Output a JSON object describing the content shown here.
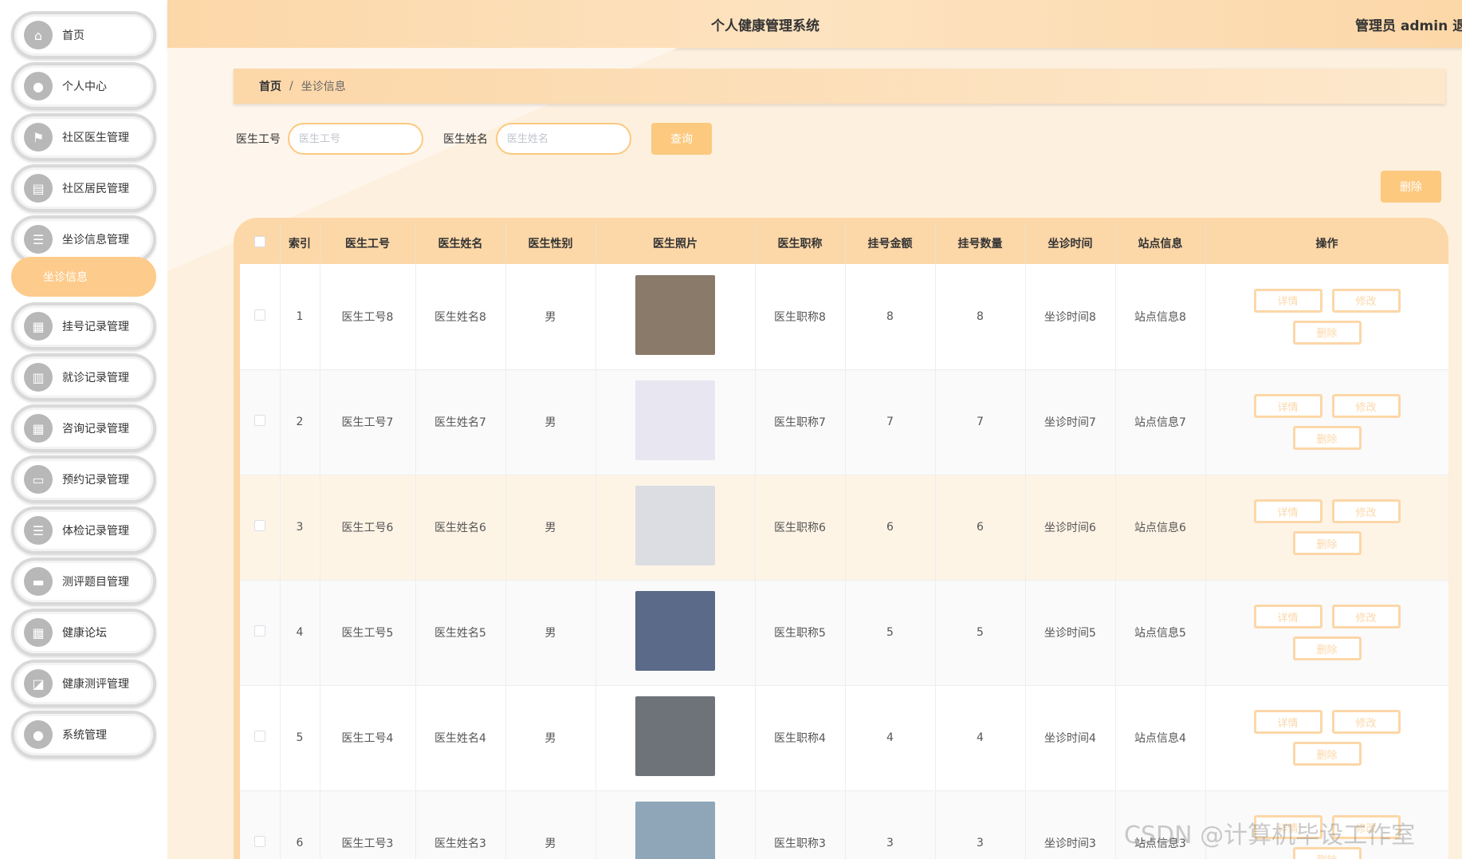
{
  "header": {
    "title": "个人健康管理系统",
    "user": "管理员 admin  退出"
  },
  "sidebar": {
    "items": [
      {
        "label": "首页",
        "icon": "home-icon",
        "glyph": "⌂"
      },
      {
        "label": "个人中心",
        "icon": "user-icon",
        "glyph": "●"
      },
      {
        "label": "社区医生管理",
        "icon": "flag-icon",
        "glyph": "⚑"
      },
      {
        "label": "社区居民管理",
        "icon": "clipboard-icon",
        "glyph": "▤"
      },
      {
        "label": "坐诊信息管理",
        "icon": "sliders-icon",
        "glyph": "☰"
      },
      {
        "label": "挂号记录管理",
        "icon": "grid-icon",
        "glyph": "▦"
      },
      {
        "label": "就诊记录管理",
        "icon": "chart-icon",
        "glyph": "▥"
      },
      {
        "label": "咨询记录管理",
        "icon": "grid-icon",
        "glyph": "▦"
      },
      {
        "label": "预约记录管理",
        "icon": "monitor-icon",
        "glyph": "▭"
      },
      {
        "label": "体检记录管理",
        "icon": "list-icon",
        "glyph": "☰"
      },
      {
        "label": "测评题目管理",
        "icon": "message-icon",
        "glyph": "▬"
      },
      {
        "label": "健康论坛",
        "icon": "grid-icon",
        "glyph": "▦"
      },
      {
        "label": "健康测评管理",
        "icon": "chart-line-icon",
        "glyph": "◪"
      },
      {
        "label": "系统管理",
        "icon": "user-icon",
        "glyph": "●"
      }
    ],
    "sub_item": "坐诊信息"
  },
  "breadcrumb": {
    "home": "首页",
    "separator": "/",
    "current": "坐诊信息"
  },
  "search": {
    "id_label": "医生工号",
    "id_placeholder": "医生工号",
    "id_value": "",
    "name_label": "医生姓名",
    "name_placeholder": "医生姓名",
    "name_value": "",
    "query_button": "查询"
  },
  "delete_button": "删除",
  "table": {
    "columns": [
      "索引",
      "医生工号",
      "医生姓名",
      "医生性别",
      "医生照片",
      "医生职称",
      "挂号金额",
      "挂号数量",
      "坐诊时间",
      "站点信息",
      "操作"
    ],
    "rows": [
      {
        "index": "1",
        "doctor_id": "医生工号8",
        "doctor_name": "医生姓名8",
        "gender": "男",
        "photo_color": "#8a7a6a",
        "title": "医生职称8",
        "fee": "8",
        "quota": "8",
        "time": "坐诊时间8",
        "site": "站点信息8"
      },
      {
        "index": "2",
        "doctor_id": "医生工号7",
        "doctor_name": "医生姓名7",
        "gender": "男",
        "photo_color": "#e8e6f0",
        "title": "医生职称7",
        "fee": "7",
        "quota": "7",
        "time": "坐诊时间7",
        "site": "站点信息7"
      },
      {
        "index": "3",
        "doctor_id": "医生工号6",
        "doctor_name": "医生姓名6",
        "gender": "男",
        "photo_color": "#dcdde3",
        "title": "医生职称6",
        "fee": "6",
        "quota": "6",
        "time": "坐诊时间6",
        "site": "站点信息6"
      },
      {
        "index": "4",
        "doctor_id": "医生工号5",
        "doctor_name": "医生姓名5",
        "gender": "男",
        "photo_color": "#5a6a88",
        "title": "医生职称5",
        "fee": "5",
        "quota": "5",
        "time": "坐诊时间5",
        "site": "站点信息5"
      },
      {
        "index": "5",
        "doctor_id": "医生工号4",
        "doctor_name": "医生姓名4",
        "gender": "男",
        "photo_color": "#6e737a",
        "title": "医生职称4",
        "fee": "4",
        "quota": "4",
        "time": "坐诊时间4",
        "site": "站点信息4"
      },
      {
        "index": "6",
        "doctor_id": "医生工号3",
        "doctor_name": "医生姓名3",
        "gender": "男",
        "photo_color": "#8fa6b8",
        "title": "医生职称3",
        "fee": "3",
        "quota": "3",
        "time": "坐诊时间3",
        "site": "站点信息3"
      }
    ],
    "actions": {
      "detail": "详情",
      "edit": "修改",
      "delete": "删除"
    }
  },
  "watermark": "CSDN @计算机毕设工作室",
  "colors": {
    "accent": "#fcc97f",
    "header": "#fcd7a8",
    "background": "#fdf0de"
  }
}
